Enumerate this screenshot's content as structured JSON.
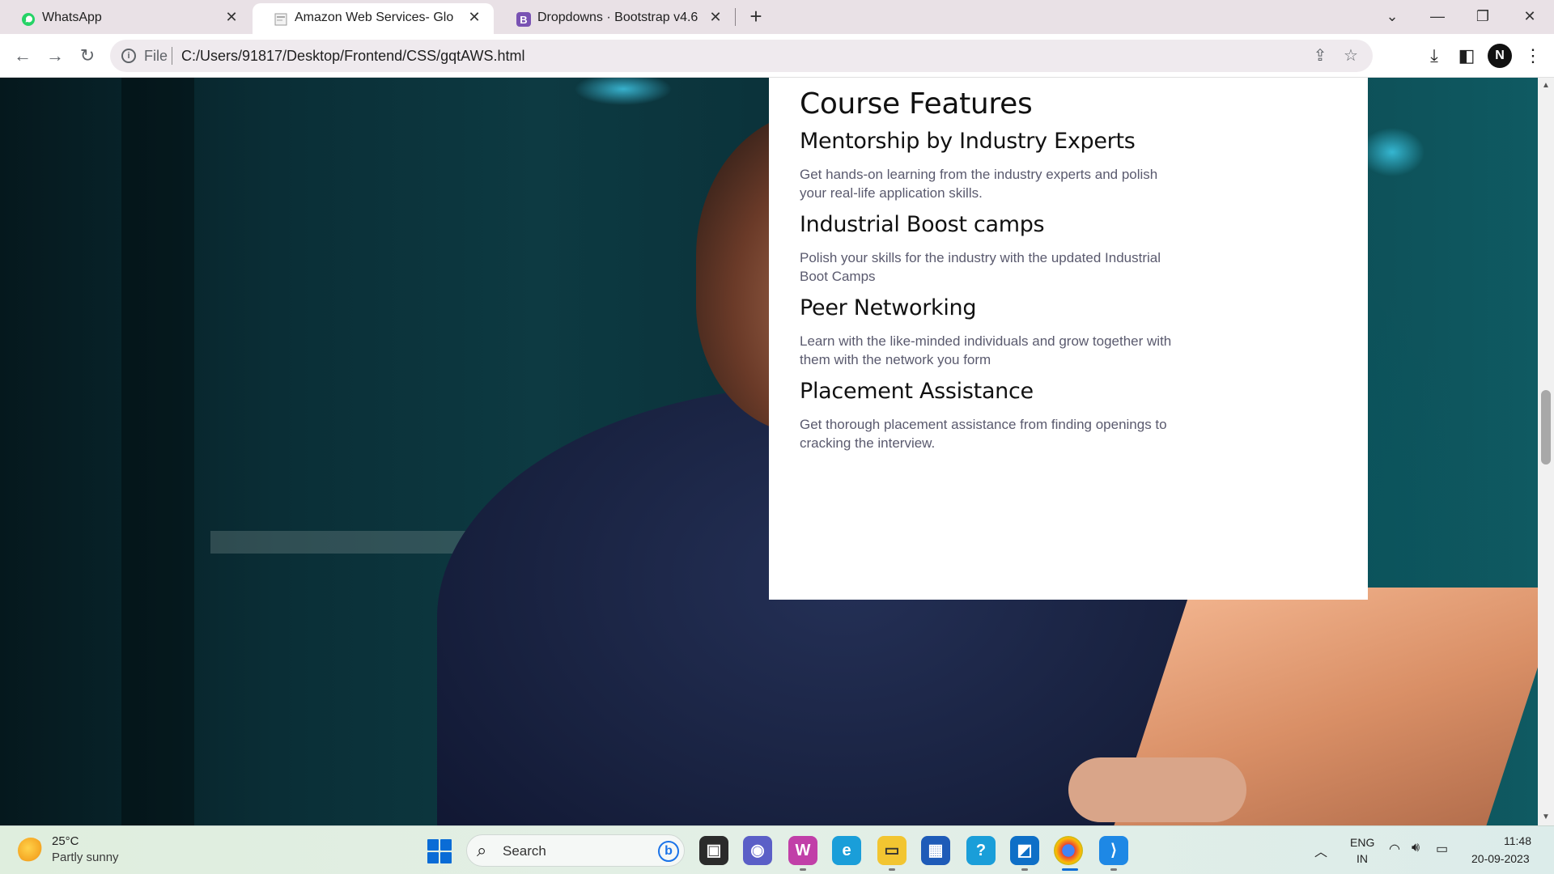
{
  "browser": {
    "tabs": [
      {
        "label": "WhatsApp",
        "active": false
      },
      {
        "label": "Amazon Web Services- Global Q",
        "active": true
      },
      {
        "label": "Dropdowns · Bootstrap v4.6",
        "active": false
      }
    ],
    "omnibox": {
      "scheme_label": "File",
      "url": "C:/Users/91817/Desktop/Frontend/CSS/gqtAWS.html"
    },
    "profile_initial": "N"
  },
  "page": {
    "heading": "Course Features",
    "features": [
      {
        "title": "Mentorship by Industry Experts",
        "text": "Get hands-on learning from the industry experts and polish your real-life application skills."
      },
      {
        "title": "Industrial Boost camps",
        "text": "Polish your skills for the industry with the updated Industrial Boot Camps"
      },
      {
        "title": "Peer Networking",
        "text": "Learn with the like-minded individuals and grow together with them with the network you form"
      },
      {
        "title": "Placement Assistance",
        "text": "Get thorough placement assistance from finding openings to cracking the interview."
      }
    ]
  },
  "taskbar": {
    "weather": {
      "temp": "25°C",
      "desc": "Partly sunny"
    },
    "search_label": "Search",
    "tray": {
      "lang_line1": "ENG",
      "lang_line2": "IN",
      "time": "11:48",
      "date": "20-09-2023"
    }
  },
  "colors": {
    "whatsapp": "#25d366",
    "bootstrap": "#7952b3",
    "accent_blue": "#0a6cd6"
  }
}
